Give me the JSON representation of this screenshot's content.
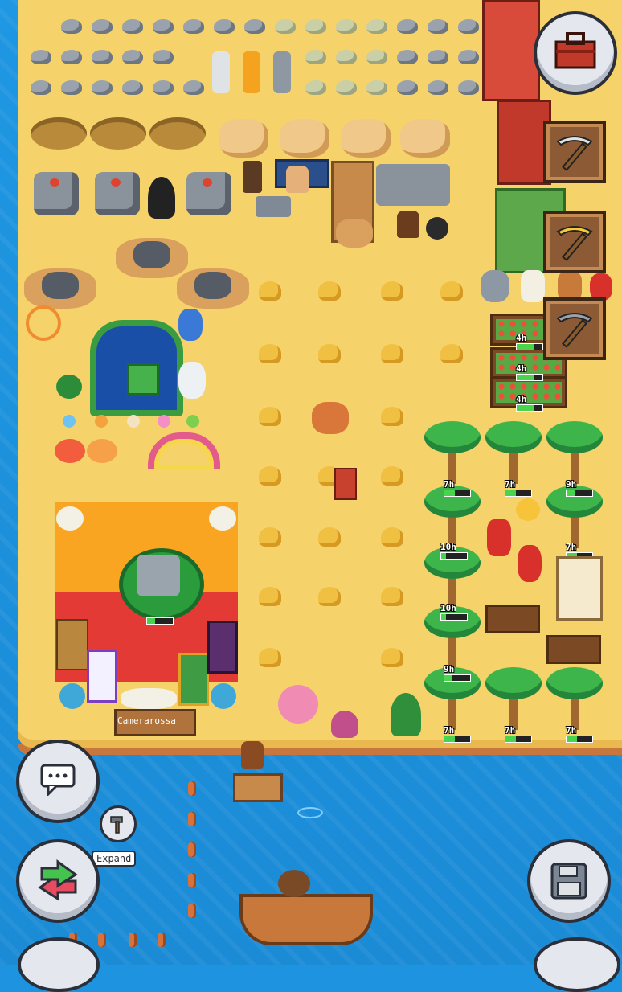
{
  "scene": {
    "title": "",
    "ocean_color": "#1e93df",
    "sand_color": "#f6d26b"
  },
  "player": {
    "name": "Camerarossa"
  },
  "crop_timers": [
    {
      "label": "4h",
      "progress": 0.7
    },
    {
      "label": "4h",
      "progress": 0.7
    },
    {
      "label": "4h",
      "progress": 0.7
    }
  ],
  "tree_timers": [
    {
      "label": "7h",
      "progress": 0.4
    },
    {
      "label": "7h",
      "progress": 0.4
    },
    {
      "label": "9h",
      "progress": 0.3
    },
    {
      "label": "10h",
      "progress": 0.2
    },
    {
      "label": "7h",
      "progress": 0.4
    },
    {
      "label": "10h",
      "progress": 0.2
    },
    {
      "label": "9h",
      "progress": 0.3
    },
    {
      "label": "7h",
      "progress": 0.4
    },
    {
      "label": "7h",
      "progress": 0.4
    },
    {
      "label": "7h",
      "progress": 0.4
    }
  ],
  "hud": {
    "chat_icon": "chat-bubble-icon",
    "hammer_icon": "hammer-icon",
    "expand_label": "Expand",
    "swap_icon": "swap-arrows-icon",
    "save_icon": "floppy-disk-icon",
    "chest_icon": "toolbox-icon",
    "tools": [
      {
        "name": "pickaxe",
        "icon": "pickaxe-icon"
      },
      {
        "name": "gold pickaxe",
        "icon": "gold-pickaxe-icon"
      },
      {
        "name": "stone pickaxe",
        "icon": "stone-pickaxe-icon"
      }
    ]
  }
}
